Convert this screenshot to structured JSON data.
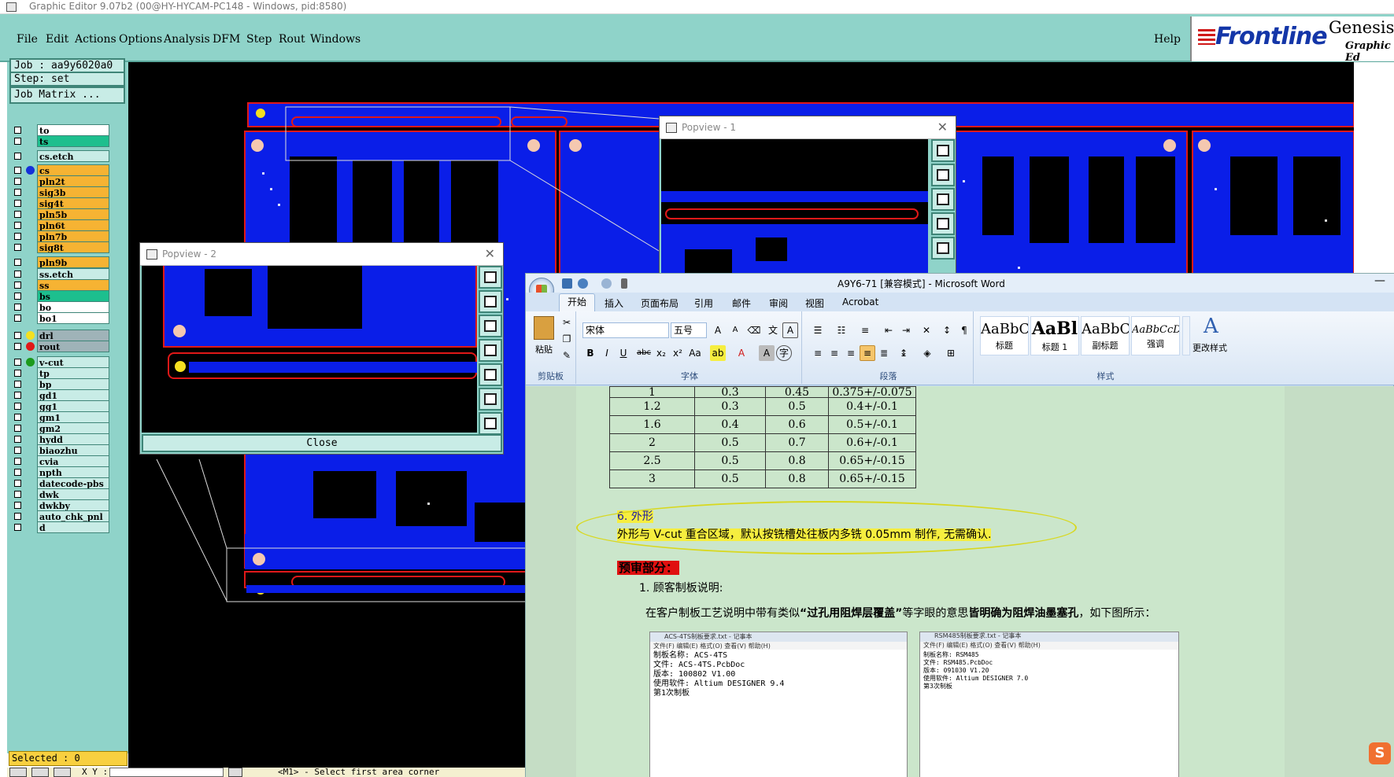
{
  "genesis": {
    "window_title": "Graphic Editor 9.07b2 (00@HY-HYCAM-PC148 - Windows, pid:8580)",
    "menus": [
      "File",
      "Edit",
      "Actions",
      "Options",
      "Analysis",
      "DFM",
      "Step",
      "Rout",
      "Windows"
    ],
    "help": "Help",
    "logo_brand": "Frontline",
    "logo_product": "Genesis",
    "logo_sub": "Graphic Ed",
    "job": "Job : aa9y6020a0",
    "step": "Step: set",
    "job_matrix": "Job Matrix ...",
    "layers": [
      {
        "name": "to",
        "color": "#ffffff",
        "dot": ""
      },
      {
        "name": "ts",
        "color": "#1dbf8e",
        "dot": ""
      },
      {
        "name": "cs.etch",
        "color": "#c8ece6",
        "dot": ""
      },
      {
        "name": "cs",
        "color": "#f6b333",
        "dot": "#1530d8"
      },
      {
        "name": "pln2t",
        "color": "#f6b333",
        "dot": ""
      },
      {
        "name": "sig3b",
        "color": "#f6b333",
        "dot": ""
      },
      {
        "name": "sig4t",
        "color": "#f6b333",
        "dot": ""
      },
      {
        "name": "pln5b",
        "color": "#f6b333",
        "dot": ""
      },
      {
        "name": "pln6t",
        "color": "#f6b333",
        "dot": ""
      },
      {
        "name": "pln7b",
        "color": "#f6b333",
        "dot": ""
      },
      {
        "name": "sig8t",
        "color": "#f6b333",
        "dot": ""
      },
      {
        "name": "pln9b",
        "color": "#f6b333",
        "dot": ""
      },
      {
        "name": "ss.etch",
        "color": "#c8ece6",
        "dot": ""
      },
      {
        "name": "ss",
        "color": "#f6b333",
        "dot": ""
      },
      {
        "name": "bs",
        "color": "#1dbf8e",
        "dot": ""
      },
      {
        "name": "bo",
        "color": "#ffffff",
        "dot": ""
      },
      {
        "name": "bo1",
        "color": "#ffffff",
        "dot": ""
      },
      {
        "name": "drl",
        "color": "#9fb3b8",
        "dot": "#f4e020"
      },
      {
        "name": "rout",
        "color": "#9fb3b8",
        "dot": "#e01818"
      },
      {
        "name": "v-cut",
        "color": "#c8ece6",
        "dot": "#1c9a1c"
      },
      {
        "name": "tp",
        "color": "#c8ece6",
        "dot": ""
      },
      {
        "name": "bp",
        "color": "#c8ece6",
        "dot": ""
      },
      {
        "name": "gd1",
        "color": "#c8ece6",
        "dot": ""
      },
      {
        "name": "gg1",
        "color": "#c8ece6",
        "dot": ""
      },
      {
        "name": "gm1",
        "color": "#c8ece6",
        "dot": ""
      },
      {
        "name": "gm2",
        "color": "#c8ece6",
        "dot": ""
      },
      {
        "name": "hydd",
        "color": "#c8ece6",
        "dot": ""
      },
      {
        "name": "biaozhu",
        "color": "#c8ece6",
        "dot": ""
      },
      {
        "name": "cvia",
        "color": "#c8ece6",
        "dot": ""
      },
      {
        "name": "npth",
        "color": "#c8ece6",
        "dot": ""
      },
      {
        "name": "datecode-pbs",
        "color": "#c8ece6",
        "dot": ""
      },
      {
        "name": "dwk",
        "color": "#c8ece6",
        "dot": ""
      },
      {
        "name": "dwkby",
        "color": "#c8ece6",
        "dot": ""
      },
      {
        "name": "auto_chk_pnl",
        "color": "#c8ece6",
        "dot": ""
      },
      {
        "name": "d",
        "color": "#c8ece6",
        "dot": ""
      }
    ],
    "selected": "Selected : 0",
    "xy_label": "X Y :",
    "status_message": "<M1> - Select first area corner",
    "popview1_title": "Popview - 1",
    "popview2_title": "Popview - 2",
    "popview2_close": "Close",
    "colors": {
      "board": "#0a1ee8",
      "outline": "#e01818",
      "teal": "#8fd3c9",
      "accent": "#f6b333"
    }
  },
  "word": {
    "title": "A9Y6-71 [兼容模式] - Microsoft Word",
    "tabs": [
      "开始",
      "插入",
      "页面布局",
      "引用",
      "邮件",
      "审阅",
      "视图",
      "Acrobat"
    ],
    "groups": {
      "clipboard": "剪贴板",
      "font": "字体",
      "paragraph": "段落",
      "styles": "样式"
    },
    "paste": "粘贴",
    "font_name": "宋体",
    "font_size": "五号",
    "styles": [
      {
        "preview": "AaBbC",
        "label": "标题"
      },
      {
        "preview": "AaBl",
        "label": "标题 1"
      },
      {
        "preview": "AaBbC",
        "label": "副标题"
      },
      {
        "preview": "AaBbCcDd",
        "label": "强调"
      }
    ],
    "change_styles": "更改样式",
    "table_rows": [
      [
        "1",
        "0.3",
        "0.45",
        "0.375+/-0.075"
      ],
      [
        "1.2",
        "0.3",
        "0.5",
        "0.4+/-0.1"
      ],
      [
        "1.6",
        "0.4",
        "0.6",
        "0.5+/-0.1"
      ],
      [
        "2",
        "0.5",
        "0.7",
        "0.6+/-0.1"
      ],
      [
        "2.5",
        "0.5",
        "0.8",
        "0.65+/-0.15"
      ],
      [
        "3",
        "0.5",
        "0.8",
        "0.65+/-0.15"
      ]
    ],
    "section_heading": "6. 外形",
    "highlight_text": "外形与 V-cut 重合区域，默认按铣槽处往板内多铣 0.05mm 制作, 无需确认.",
    "review_heading": "预审部分：",
    "item1": "1. 顾客制板说明:",
    "paragraph_prefix": "在客户制板工艺说明中带有类似",
    "paragraph_bold1": "“过孔用阻焊层覆盖”",
    "paragraph_mid": "等字眼的意思",
    "paragraph_bold2": "皆明确为阻焊油墨塞孔",
    "paragraph_suffix": "，如下图所示：",
    "notepad1": {
      "title": "ACS-4TS制板要求.txt - 记事本",
      "menu": "文件(F)  编辑(E)  格式(O)  查看(V)  帮助(H)",
      "body": "制板名称: ACS-4TS\n文件: ACS-4TS.PcbDoc\n版本: 100802 V1.00\n使用软件: Altium DESIGNER 9.4\n第1次制板"
    },
    "notepad2": {
      "title": "RSM485制板要求.txt - 记事本",
      "menu": "文件(F)  编辑(E)  格式(O)  查看(V)  帮助(H)",
      "body": "制板名称: RSM485\n文件: RSM485.PcbDoc\n版本: 091030 V1.20\n使用软件: Altium DESIGNER 7.0\n第3次制板"
    },
    "sogou_label": "S"
  }
}
